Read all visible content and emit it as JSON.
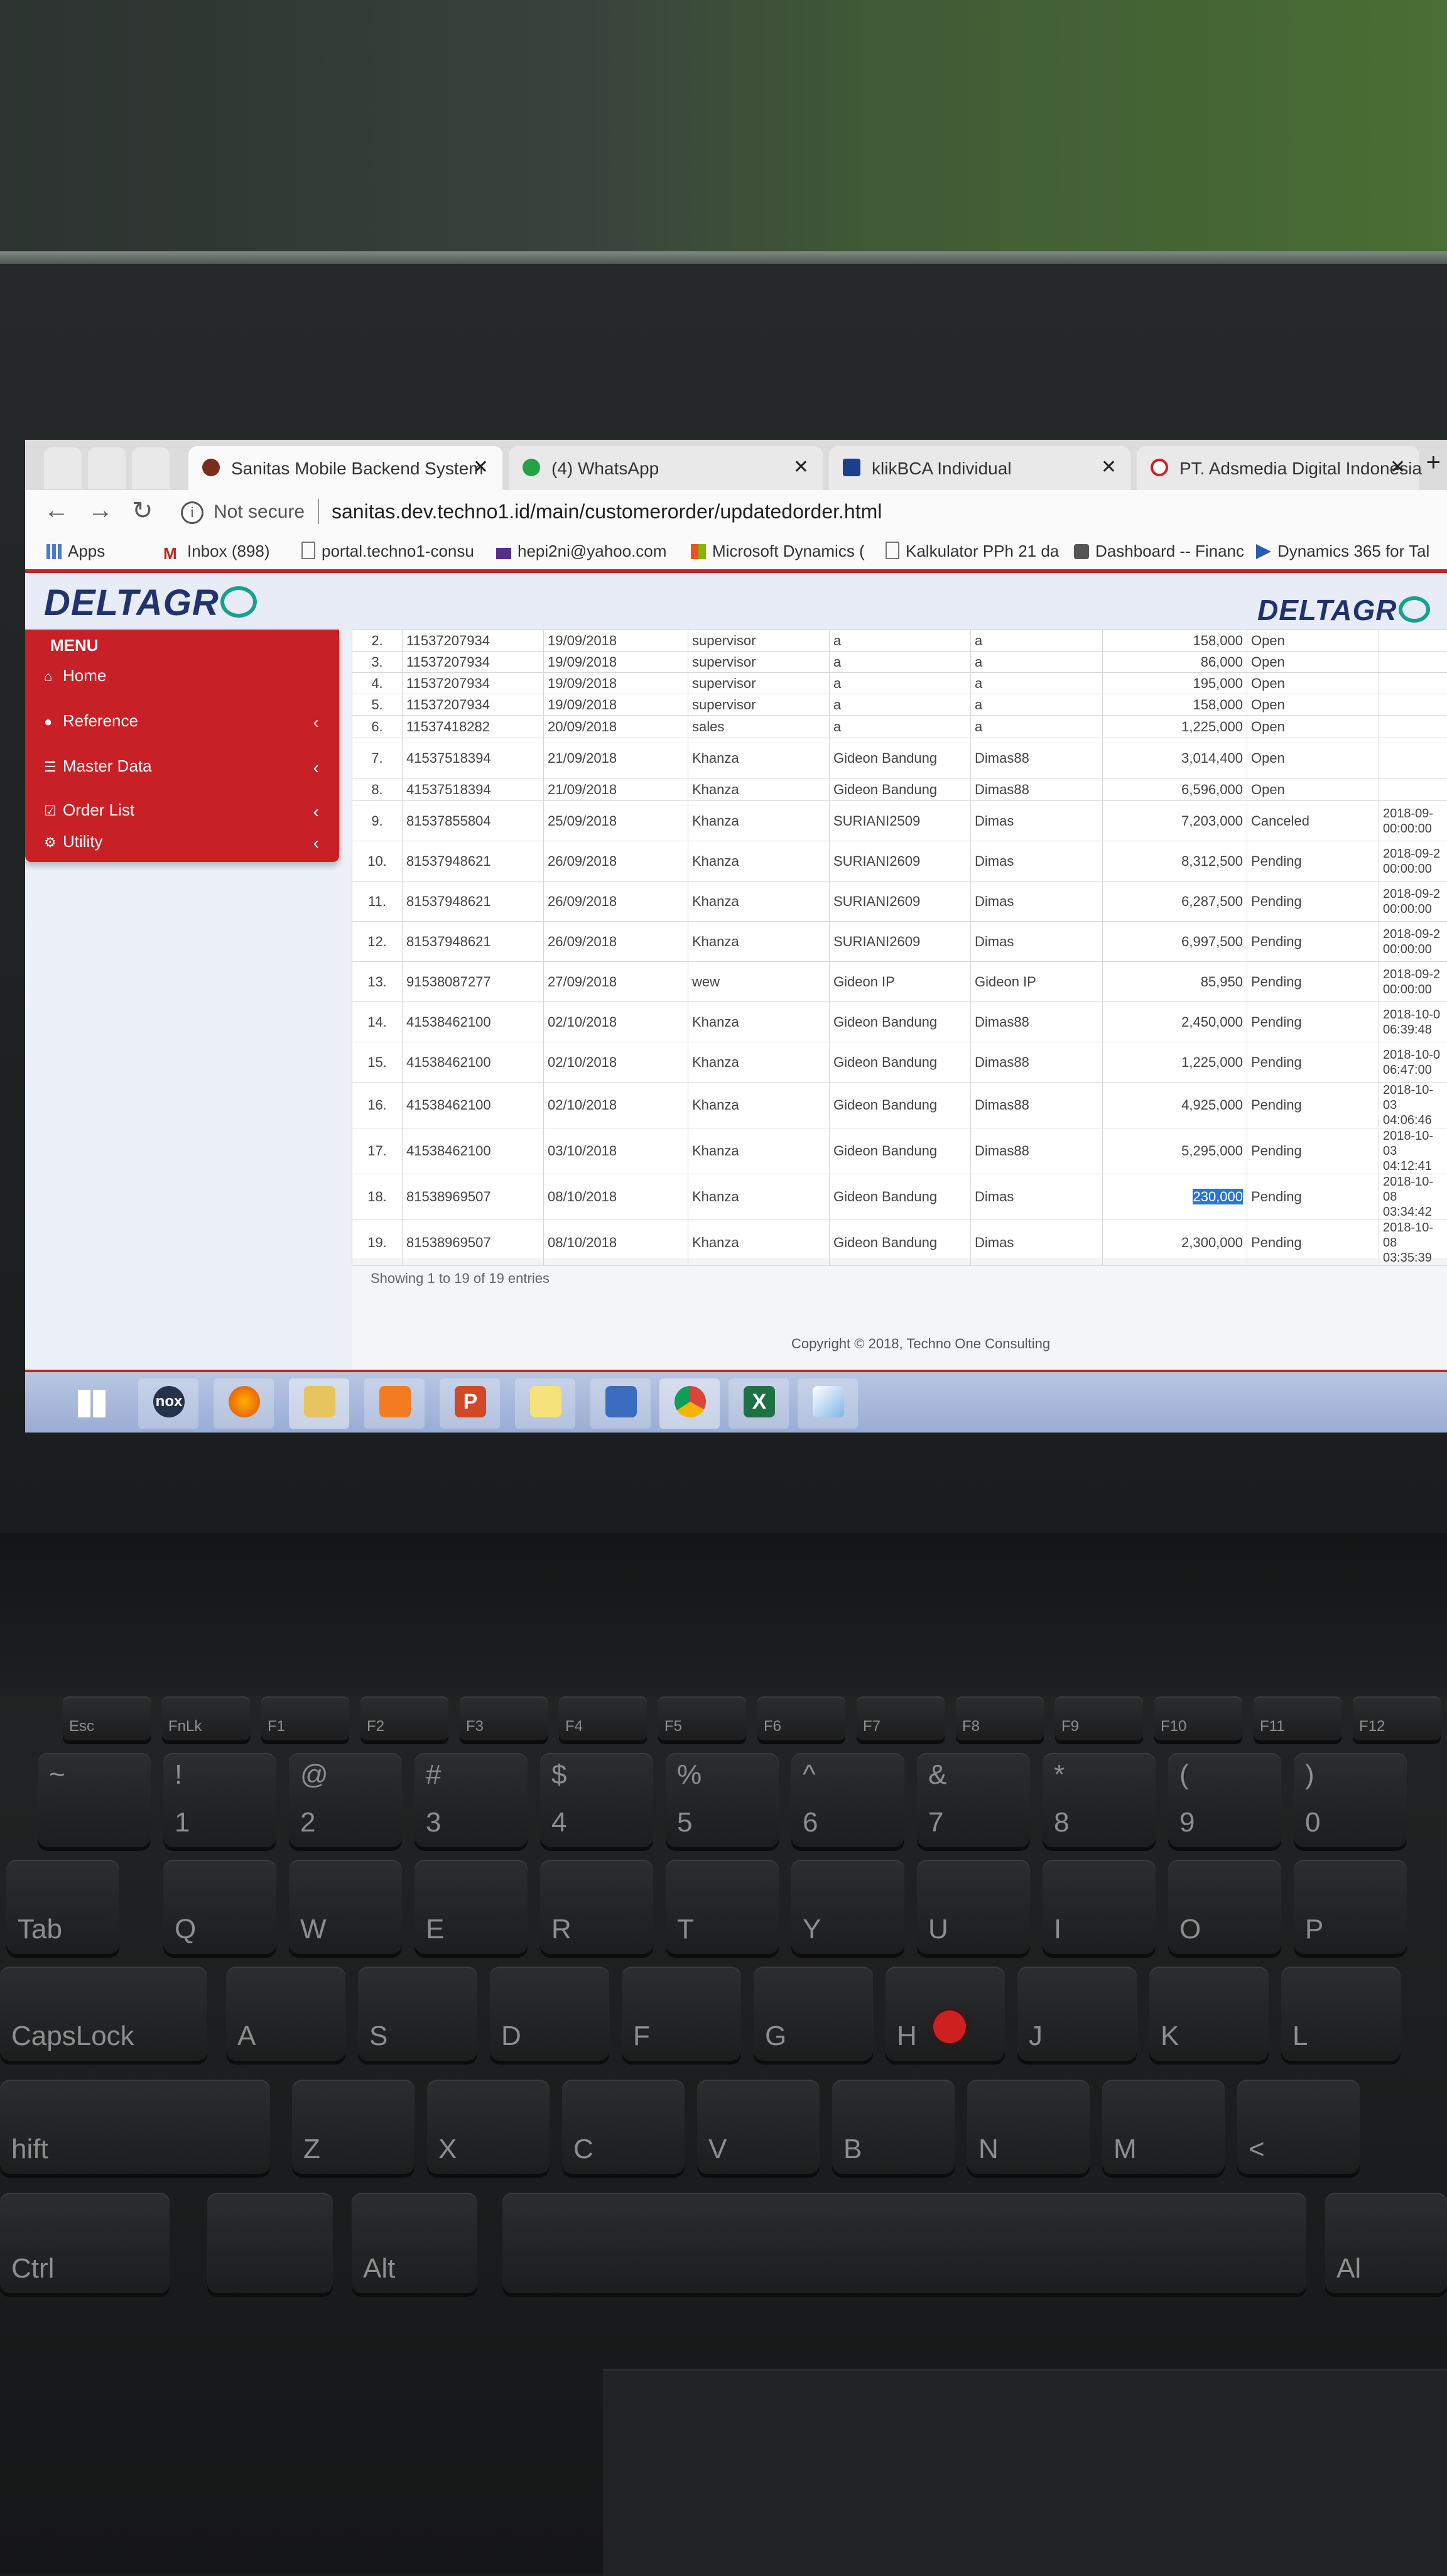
{
  "browser": {
    "tabs": [
      {
        "title": "Sanitas Mobile Backend System",
        "active": true
      },
      {
        "title": "(4) WhatsApp",
        "active": false
      },
      {
        "title": "klikBCA Individual",
        "active": false
      },
      {
        "title": "PT. Adsmedia Digital Indonesia",
        "active": false
      }
    ],
    "not_secure_label": "Not secure",
    "url": "sanitas.dev.techno1.id/main/customerorder/updatedorder.html",
    "bookmarks": [
      {
        "label": "Apps",
        "icon": "apps-grid-icon"
      },
      {
        "label": "Inbox (898)",
        "icon": "gmail-icon"
      },
      {
        "label": "portal.techno1-consu",
        "icon": "page-icon"
      },
      {
        "label": "hepi2ni@yahoo.com",
        "icon": "mail-icon"
      },
      {
        "label": "Microsoft Dynamics (",
        "icon": "microsoft-icon"
      },
      {
        "label": "Kalkulator PPh 21 da",
        "icon": "page-icon"
      },
      {
        "label": "Dashboard -- Financ",
        "icon": "dashboard-icon"
      },
      {
        "label": "Dynamics 365 for Tal",
        "icon": "dynamics-icon"
      }
    ]
  },
  "app": {
    "logo_text": "DELTAGR",
    "logo_right_text": "DELTAGR",
    "logo_right_suffix": "O",
    "menu": {
      "title": "MENU",
      "items": [
        {
          "label": "Home",
          "icon": "home-icon",
          "has_submenu": false
        },
        {
          "label": "Reference",
          "icon": "circle-icon",
          "has_submenu": true
        },
        {
          "label": "Master Data",
          "icon": "database-icon",
          "has_submenu": true
        },
        {
          "label": "Order List",
          "icon": "checkbox-icon",
          "has_submenu": true
        },
        {
          "label": "Utility",
          "icon": "cogs-icon",
          "has_submenu": true
        }
      ]
    },
    "orders": [
      {
        "no": "2.",
        "order_id": "11537207934",
        "date": "19/09/2018",
        "user": "supervisor",
        "customer": "a",
        "salesman": "a",
        "total": "158,000",
        "status": "Open",
        "timestamp": ""
      },
      {
        "no": "3.",
        "order_id": "11537207934",
        "date": "19/09/2018",
        "user": "supervisor",
        "customer": "a",
        "salesman": "a",
        "total": "86,000",
        "status": "Open",
        "timestamp": ""
      },
      {
        "no": "4.",
        "order_id": "11537207934",
        "date": "19/09/2018",
        "user": "supervisor",
        "customer": "a",
        "salesman": "a",
        "total": "195,000",
        "status": "Open",
        "timestamp": ""
      },
      {
        "no": "5.",
        "order_id": "11537207934",
        "date": "19/09/2018",
        "user": "supervisor",
        "customer": "a",
        "salesman": "a",
        "total": "158,000",
        "status": "Open",
        "timestamp": ""
      },
      {
        "no": "6.",
        "order_id": "11537418282",
        "date": "20/09/2018",
        "user": "sales",
        "customer": "a",
        "salesman": "a",
        "total": "1,225,000",
        "status": "Open",
        "timestamp": ""
      },
      {
        "no": "7.",
        "order_id": "41537518394",
        "date": "21/09/2018",
        "user": "Khanza",
        "customer": "Gideon Bandung",
        "salesman": "Dimas88",
        "total": "3,014,400",
        "status": "Open",
        "timestamp": ""
      },
      {
        "no": "8.",
        "order_id": "41537518394",
        "date": "21/09/2018",
        "user": "Khanza",
        "customer": "Gideon Bandung",
        "salesman": "Dimas88",
        "total": "6,596,000",
        "status": "Open",
        "timestamp": ""
      },
      {
        "no": "9.",
        "order_id": "81537855804",
        "date": "25/09/2018",
        "user": "Khanza",
        "customer": "SURIANI2509",
        "salesman": "Dimas",
        "total": "7,203,000",
        "status": "Canceled",
        "timestamp": "2018-09-\n00:00:00"
      },
      {
        "no": "10.",
        "order_id": "81537948621",
        "date": "26/09/2018",
        "user": "Khanza",
        "customer": "SURIANI2609",
        "salesman": "Dimas",
        "total": "8,312,500",
        "status": "Pending",
        "timestamp": "2018-09-2\n00:00:00"
      },
      {
        "no": "11.",
        "order_id": "81537948621",
        "date": "26/09/2018",
        "user": "Khanza",
        "customer": "SURIANI2609",
        "salesman": "Dimas",
        "total": "6,287,500",
        "status": "Pending",
        "timestamp": "2018-09-2\n00:00:00"
      },
      {
        "no": "12.",
        "order_id": "81537948621",
        "date": "26/09/2018",
        "user": "Khanza",
        "customer": "SURIANI2609",
        "salesman": "Dimas",
        "total": "6,997,500",
        "status": "Pending",
        "timestamp": "2018-09-2\n00:00:00"
      },
      {
        "no": "13.",
        "order_id": "91538087277",
        "date": "27/09/2018",
        "user": "wew",
        "customer": "Gideon IP",
        "salesman": "Gideon IP",
        "total": "85,950",
        "status": "Pending",
        "timestamp": "2018-09-2\n00:00:00"
      },
      {
        "no": "14.",
        "order_id": "41538462100",
        "date": "02/10/2018",
        "user": "Khanza",
        "customer": "Gideon Bandung",
        "salesman": "Dimas88",
        "total": "2,450,000",
        "status": "Pending",
        "timestamp": "2018-10-0\n06:39:48"
      },
      {
        "no": "15.",
        "order_id": "41538462100",
        "date": "02/10/2018",
        "user": "Khanza",
        "customer": "Gideon Bandung",
        "salesman": "Dimas88",
        "total": "1,225,000",
        "status": "Pending",
        "timestamp": "2018-10-0\n06:47:00"
      },
      {
        "no": "16.",
        "order_id": "41538462100",
        "date": "02/10/2018",
        "user": "Khanza",
        "customer": "Gideon Bandung",
        "salesman": "Dimas88",
        "total": "4,925,000",
        "status": "Pending",
        "timestamp": "2018-10-03\n04:06:46"
      },
      {
        "no": "17.",
        "order_id": "41538462100",
        "date": "03/10/2018",
        "user": "Khanza",
        "customer": "Gideon Bandung",
        "salesman": "Dimas88",
        "total": "5,295,000",
        "status": "Pending",
        "timestamp": "2018-10-03\n04:12:41"
      },
      {
        "no": "18.",
        "order_id": "81538969507",
        "date": "08/10/2018",
        "user": "Khanza",
        "customer": "Gideon Bandung",
        "salesman": "Dimas",
        "total": "230,000",
        "status": "Pending",
        "timestamp": "2018-10-08\n03:34:42",
        "total_selected": true
      },
      {
        "no": "19.",
        "order_id": "81538969507",
        "date": "08/10/2018",
        "user": "Khanza",
        "customer": "Gideon Bandung",
        "salesman": "Dimas",
        "total": "2,300,000",
        "status": "Pending",
        "timestamp": "2018-10-08\n03:35:39"
      }
    ],
    "table_info": "Showing 1 to 19 of 19 entries",
    "copyright": "Copyright © 2018, Techno One Consulting"
  },
  "taskbar": {
    "apps": [
      {
        "name": "windows-start-icon"
      },
      {
        "name": "nox-icon",
        "label": "nox"
      },
      {
        "name": "firefox-icon"
      },
      {
        "name": "file-explorer-icon"
      },
      {
        "name": "xampp-icon"
      },
      {
        "name": "powerpoint-icon",
        "label": "P"
      },
      {
        "name": "notes-icon"
      },
      {
        "name": "remote-desktop-icon"
      },
      {
        "name": "chrome-icon"
      },
      {
        "name": "excel-icon",
        "label": "X"
      },
      {
        "name": "paint-icon"
      }
    ]
  },
  "keyboard": {
    "fn_row": [
      "Esc",
      "FnLk",
      "F1",
      "F2",
      "F3",
      "F4",
      "F5",
      "F6",
      "F7",
      "F8",
      "F9",
      "F10",
      "F11",
      "F12"
    ],
    "number_row": [
      {
        "top": "~",
        "bottom": ""
      },
      {
        "top": "!",
        "bottom": "1"
      },
      {
        "top": "@",
        "bottom": "2"
      },
      {
        "top": "#",
        "bottom": "3"
      },
      {
        "top": "$",
        "bottom": "4"
      },
      {
        "top": "%",
        "bottom": "5"
      },
      {
        "top": "^",
        "bottom": "6"
      },
      {
        "top": "&",
        "bottom": "7"
      },
      {
        "top": "*",
        "bottom": "8"
      },
      {
        "top": "(",
        "bottom": "9"
      },
      {
        "top": ")",
        "bottom": "0"
      }
    ],
    "row_q": [
      "Tab",
      "Q",
      "W",
      "E",
      "R",
      "T",
      "Y",
      "U",
      "I",
      "O",
      "P"
    ],
    "row_a": [
      "CapsLock",
      "A",
      "S",
      "D",
      "F",
      "G",
      "H",
      "J",
      "K",
      "L"
    ],
    "row_z": [
      "hift",
      "Z",
      "X",
      "C",
      "V",
      "B",
      "N",
      "M",
      "<"
    ],
    "row_bottom": [
      "Ctrl",
      "",
      "Alt",
      "",
      "Al"
    ]
  }
}
